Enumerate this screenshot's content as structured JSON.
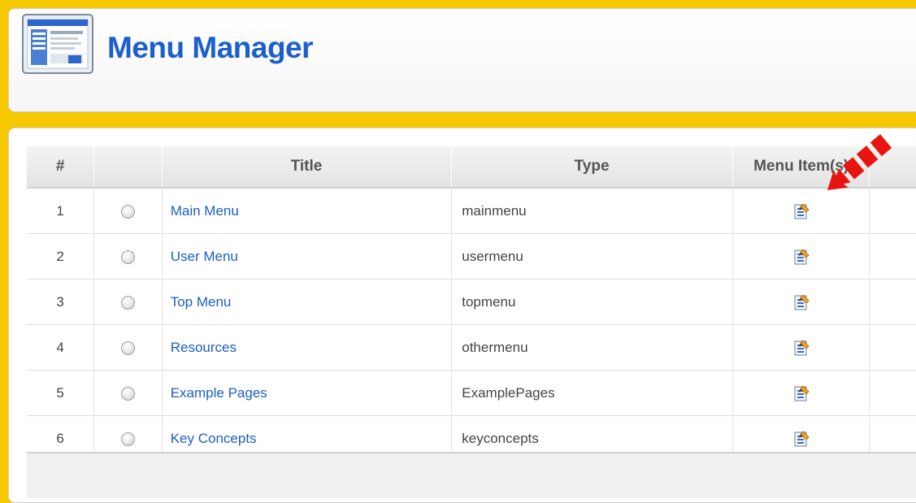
{
  "header": {
    "title": "Menu Manager",
    "icon": "menu-manager-icon"
  },
  "table": {
    "columns": [
      "#",
      "",
      "Title",
      "Type",
      "Menu Item(s)",
      "#"
    ],
    "rows": [
      {
        "num": "1",
        "title": "Main Menu",
        "type": "mainmenu"
      },
      {
        "num": "2",
        "title": "User Menu",
        "type": "usermenu"
      },
      {
        "num": "3",
        "title": "Top Menu",
        "type": "topmenu"
      },
      {
        "num": "4",
        "title": "Resources",
        "type": "othermenu"
      },
      {
        "num": "5",
        "title": "Example Pages",
        "type": "ExamplePages"
      },
      {
        "num": "6",
        "title": "Key Concepts",
        "type": "keyconcepts"
      }
    ],
    "row_icon": "edit-menu-items-icon"
  },
  "annotation": {
    "icon": "red-arrow-annotation",
    "color": "#e8140f"
  },
  "colors": {
    "background_accent": "#f5c800",
    "title_blue": "#1c5ecb",
    "link_blue": "#1b5fc6"
  }
}
